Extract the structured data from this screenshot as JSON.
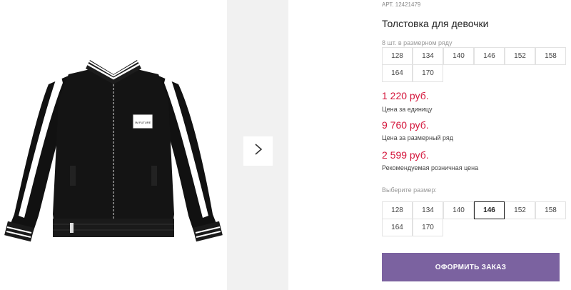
{
  "product": {
    "article": "АРТ. 12421479",
    "title": "Толстовка для девочки",
    "jacket_patch": "I'M FUTURE"
  },
  "row_note": {
    "main": "8 шт. в размерном ряду",
    "partial": ""
  },
  "size_row": [
    "128",
    "134",
    "140",
    "146",
    "152",
    "158",
    "164",
    "170"
  ],
  "prices": {
    "unit_price": "1 220 руб.",
    "unit_label": "Цена за единицу",
    "row_price": "9 760 руб.",
    "row_label": "Цена за размерный ряд",
    "retail_price": "2 599 руб.",
    "retail_label": "Рекомендуемая розничная цена"
  },
  "size_select": {
    "label": "Выберите размер:",
    "options": [
      "128",
      "134",
      "140",
      "146",
      "152",
      "158",
      "164",
      "170"
    ],
    "selected": "146"
  },
  "order_button": "ОФОРМИТЬ ЗАКАЗ",
  "colors": {
    "price": "#d4143a",
    "button": "#7b62a0",
    "thumb_bg": "#f1f1f1"
  },
  "icons": {
    "next": "chevron-right-icon"
  }
}
